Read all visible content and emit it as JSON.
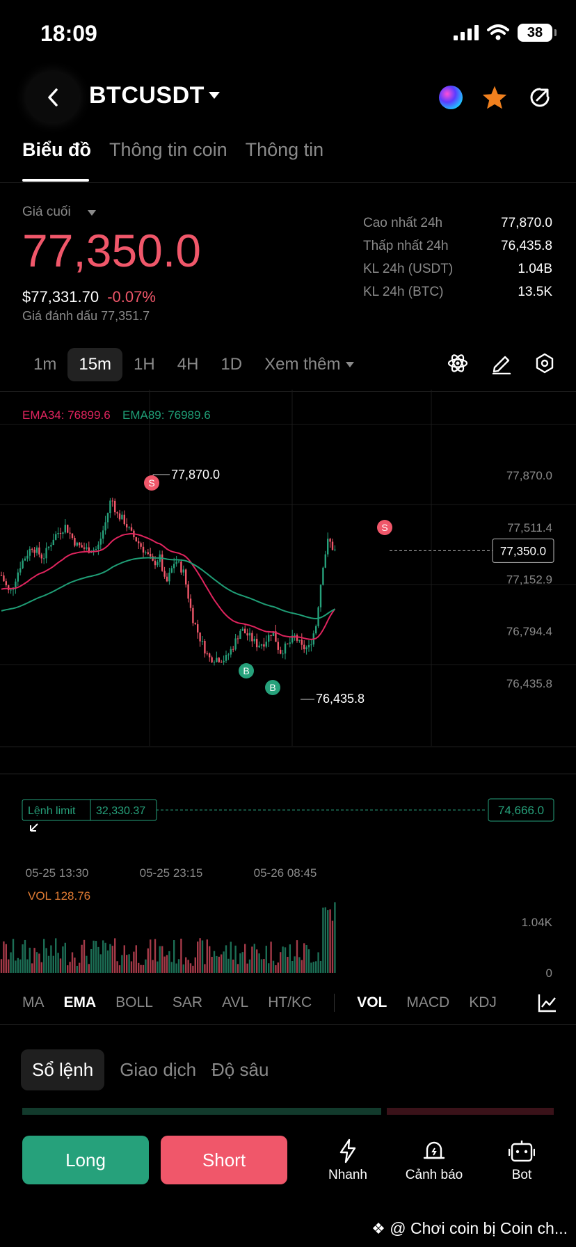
{
  "status": {
    "time": "18:09",
    "battery": "38"
  },
  "header": {
    "pair": "BTCUSDT"
  },
  "tabs": [
    "Biểu đồ",
    "Thông tin coin",
    "Thông tin"
  ],
  "price_panel": {
    "last_label": "Giá cuối",
    "last_price": "77,350.0",
    "usd_price": "$77,331.70",
    "change": "-0.07%",
    "mark_price": "Giá đánh dấu 77,351.7",
    "stats": [
      {
        "label": "Cao nhất 24h",
        "value": "77,870.0"
      },
      {
        "label": "Thấp nhất 24h",
        "value": "76,435.8"
      },
      {
        "label": "KL 24h (USDT)",
        "value": "1.04B"
      },
      {
        "label": "KL 24h (BTC)",
        "value": "13.5K"
      }
    ]
  },
  "timeframes": {
    "items": [
      "1m",
      "15m",
      "1H",
      "4H",
      "1D"
    ],
    "more": "Xem thêm",
    "selected": "15m"
  },
  "chart": {
    "ema34": "EMA34: 76899.6",
    "ema89": "EMA89: 76989.6",
    "high_marker": "77,870.0",
    "low_marker": "76,435.8",
    "y_ticks": [
      "77,870.0",
      "77,511.4",
      "77,152.9",
      "76,794.4",
      "76,435.8"
    ],
    "current_price": "77,350.0",
    "limit_label": "Lệnh limit",
    "limit_value": "32,330.37",
    "limit_price": "74,666.0",
    "x_ticks": [
      "05-25 13:30",
      "05-25 23:15",
      "05-26 08:45"
    ],
    "signal_sell": "S",
    "signal_buy": "B",
    "vol_label": "VOL 128.76",
    "vol_max": "1.04K",
    "vol_min": "0",
    "colors": {
      "up": "#26a17b",
      "down": "#f0576a",
      "ema34": "#e0245e",
      "ema89": "#1f9e76"
    }
  },
  "indicators": [
    "MA",
    "EMA",
    "BOLL",
    "SAR",
    "AVL",
    "HT/KC",
    "VOL",
    "MACD",
    "KDJ"
  ],
  "active_indicators": [
    "EMA",
    "VOL"
  ],
  "orderbook_tabs": [
    "Sổ lệnh",
    "Giao dịch",
    "Độ sâu"
  ],
  "actions": {
    "long": "Long",
    "short": "Short",
    "quick": "Nhanh",
    "alert": "Cảnh báo",
    "bot": "Bot"
  },
  "footer": "@ Chơi coin bị Coin ch..."
}
